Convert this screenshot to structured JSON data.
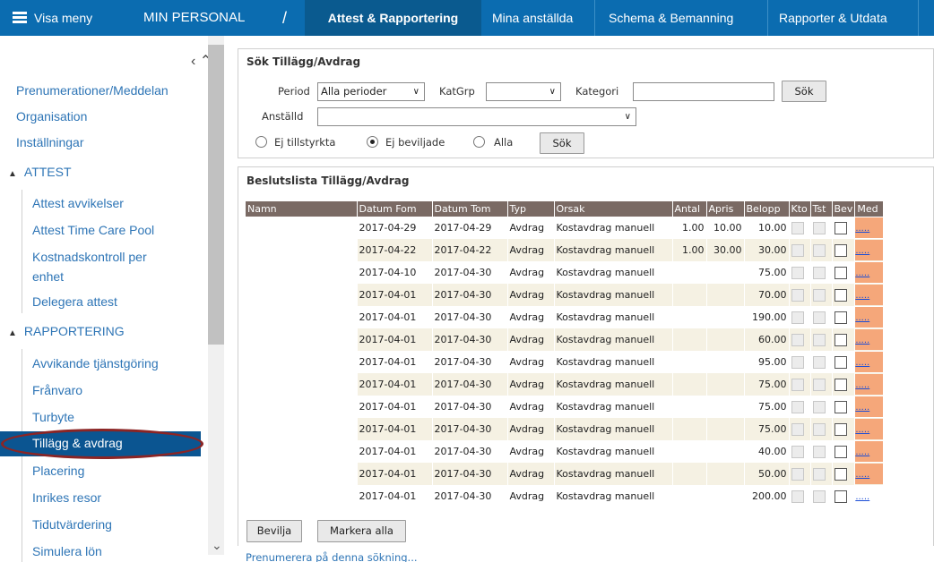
{
  "topnav": {
    "menu_label": "Visa meny",
    "section": "MIN PERSONAL",
    "separator": "/",
    "tabs": [
      "Attest & Rapportering",
      "Mina anställda",
      "Schema & Bemanning",
      "Rapporter & Utdata"
    ]
  },
  "sidebar": {
    "links": [
      "Prenumerationer/Meddelan",
      "Organisation",
      "Inställningar"
    ],
    "attest_header": "ATTEST",
    "attest_items": [
      "Attest avvikelser",
      "Attest Time Care Pool",
      "Kostnadskontroll per",
      "enhet",
      "Delegera attest"
    ],
    "rapportering_header": "RAPPORTERING",
    "rapportering_items": [
      "Avvikande tjänstgöring",
      "Frånvaro",
      "Turbyte",
      "Tillägg & avdrag",
      "Placering",
      "Inrikes resor",
      "Tidutvärdering",
      "Simulera lön"
    ]
  },
  "search": {
    "title": "Sök Tillägg/Avdrag",
    "period_label": "Period",
    "period_value": "Alla perioder",
    "katgrp_label": "KatGrp",
    "katgrp_value": "",
    "kategori_label": "Kategori",
    "kategori_value": "",
    "search_button": "Sök",
    "anstalld_label": "Anställd",
    "anstalld_value": "",
    "radio_options": [
      "Ej tillstyrkta",
      "Ej beviljade",
      "Alla"
    ],
    "radio_selected": "Ej beviljade",
    "search_button2": "Sök"
  },
  "decision": {
    "title": "Beslutslista Tillägg/Avdrag",
    "columns": [
      "Namn",
      "Datum Fom",
      "Datum Tom",
      "Typ",
      "Orsak",
      "Antal",
      "Apris",
      "Belopp",
      "Kto",
      "Tst",
      "Bev",
      "Med"
    ],
    "rows": [
      {
        "fom": "2017-04-29",
        "tom": "2017-04-29",
        "typ": "Avdrag",
        "orsak": "Kostavdrag manuell",
        "antal": "1.00",
        "apris": "10.00",
        "belopp": "10.00",
        "med": "....."
      },
      {
        "fom": "2017-04-22",
        "tom": "2017-04-22",
        "typ": "Avdrag",
        "orsak": "Kostavdrag manuell",
        "antal": "1.00",
        "apris": "30.00",
        "belopp": "30.00",
        "med": "....."
      },
      {
        "fom": "2017-04-10",
        "tom": "2017-04-30",
        "typ": "Avdrag",
        "orsak": "Kostavdrag manuell",
        "antal": "",
        "apris": "",
        "belopp": "75.00",
        "med": "....."
      },
      {
        "fom": "2017-04-01",
        "tom": "2017-04-30",
        "typ": "Avdrag",
        "orsak": "Kostavdrag manuell",
        "antal": "",
        "apris": "",
        "belopp": "70.00",
        "med": "....."
      },
      {
        "fom": "2017-04-01",
        "tom": "2017-04-30",
        "typ": "Avdrag",
        "orsak": "Kostavdrag manuell",
        "antal": "",
        "apris": "",
        "belopp": "190.00",
        "med": "....."
      },
      {
        "fom": "2017-04-01",
        "tom": "2017-04-30",
        "typ": "Avdrag",
        "orsak": "Kostavdrag manuell",
        "antal": "",
        "apris": "",
        "belopp": "60.00",
        "med": "....."
      },
      {
        "fom": "2017-04-01",
        "tom": "2017-04-30",
        "typ": "Avdrag",
        "orsak": "Kostavdrag manuell",
        "antal": "",
        "apris": "",
        "belopp": "95.00",
        "med": "....."
      },
      {
        "fom": "2017-04-01",
        "tom": "2017-04-30",
        "typ": "Avdrag",
        "orsak": "Kostavdrag manuell",
        "antal": "",
        "apris": "",
        "belopp": "75.00",
        "med": "....."
      },
      {
        "fom": "2017-04-01",
        "tom": "2017-04-30",
        "typ": "Avdrag",
        "orsak": "Kostavdrag manuell",
        "antal": "",
        "apris": "",
        "belopp": "75.00",
        "med": "....."
      },
      {
        "fom": "2017-04-01",
        "tom": "2017-04-30",
        "typ": "Avdrag",
        "orsak": "Kostavdrag manuell",
        "antal": "",
        "apris": "",
        "belopp": "75.00",
        "med": "....."
      },
      {
        "fom": "2017-04-01",
        "tom": "2017-04-30",
        "typ": "Avdrag",
        "orsak": "Kostavdrag manuell",
        "antal": "",
        "apris": "",
        "belopp": "40.00",
        "med": "....."
      },
      {
        "fom": "2017-04-01",
        "tom": "2017-04-30",
        "typ": "Avdrag",
        "orsak": "Kostavdrag manuell",
        "antal": "",
        "apris": "",
        "belopp": "50.00",
        "med": "....."
      },
      {
        "fom": "2017-04-01",
        "tom": "2017-04-30",
        "typ": "Avdrag",
        "orsak": "Kostavdrag manuell",
        "antal": "",
        "apris": "",
        "belopp": "200.00",
        "med": "....."
      }
    ],
    "approve_button": "Bevilja",
    "mark_all_button": "Markera alla",
    "subscribe_link": "Prenumerera på denna sökning..."
  },
  "colors": {
    "nav": "#0b6cb0",
    "active_item": "#0b5591",
    "table_header": "#7a6a64",
    "med_cell": "#f5a77a",
    "highlight": "#8b2525"
  }
}
